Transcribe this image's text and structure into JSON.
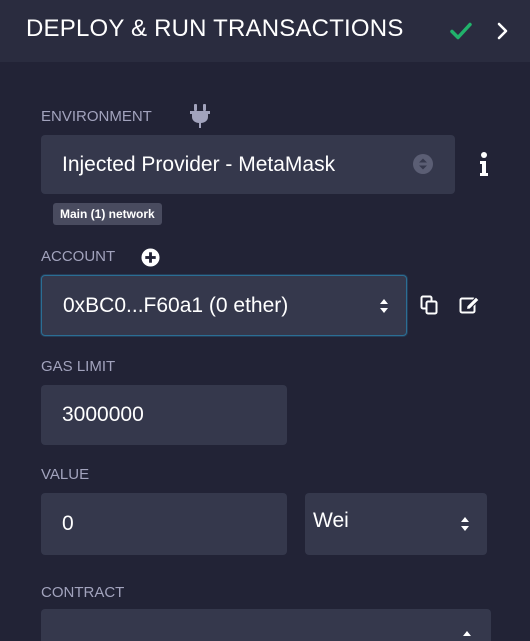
{
  "header": {
    "title": "DEPLOY & RUN TRANSACTIONS",
    "check_icon": "check-icon",
    "chevron_icon": "chevron-right-icon",
    "check_color": "#21b26b"
  },
  "environment": {
    "label": "ENVIRONMENT",
    "label_icon": "plug-icon",
    "value": "Injected Provider - MetaMask",
    "select_icon": "select-updown-icon",
    "info_icon": "info-icon",
    "network_badge": "Main (1) network"
  },
  "account": {
    "label": "ACCOUNT",
    "label_icon": "plus-circle-icon",
    "value": "0xBC0...F60a1 (0 ether)",
    "select_icon": "updown-arrows-icon",
    "copy_icon": "copy-icon",
    "edit_icon": "edit-icon"
  },
  "gas_limit": {
    "label": "GAS LIMIT",
    "value": "3000000"
  },
  "value": {
    "label": "VALUE",
    "amount": "0",
    "unit": "Wei",
    "unit_select_icon": "updown-arrows-icon"
  },
  "contract": {
    "label": "CONTRACT"
  },
  "colors": {
    "background": "#222336",
    "header": "#2a2c3f",
    "field": "#35384c",
    "label": "#a2a3bd",
    "accent_border": "#2b6e94"
  }
}
